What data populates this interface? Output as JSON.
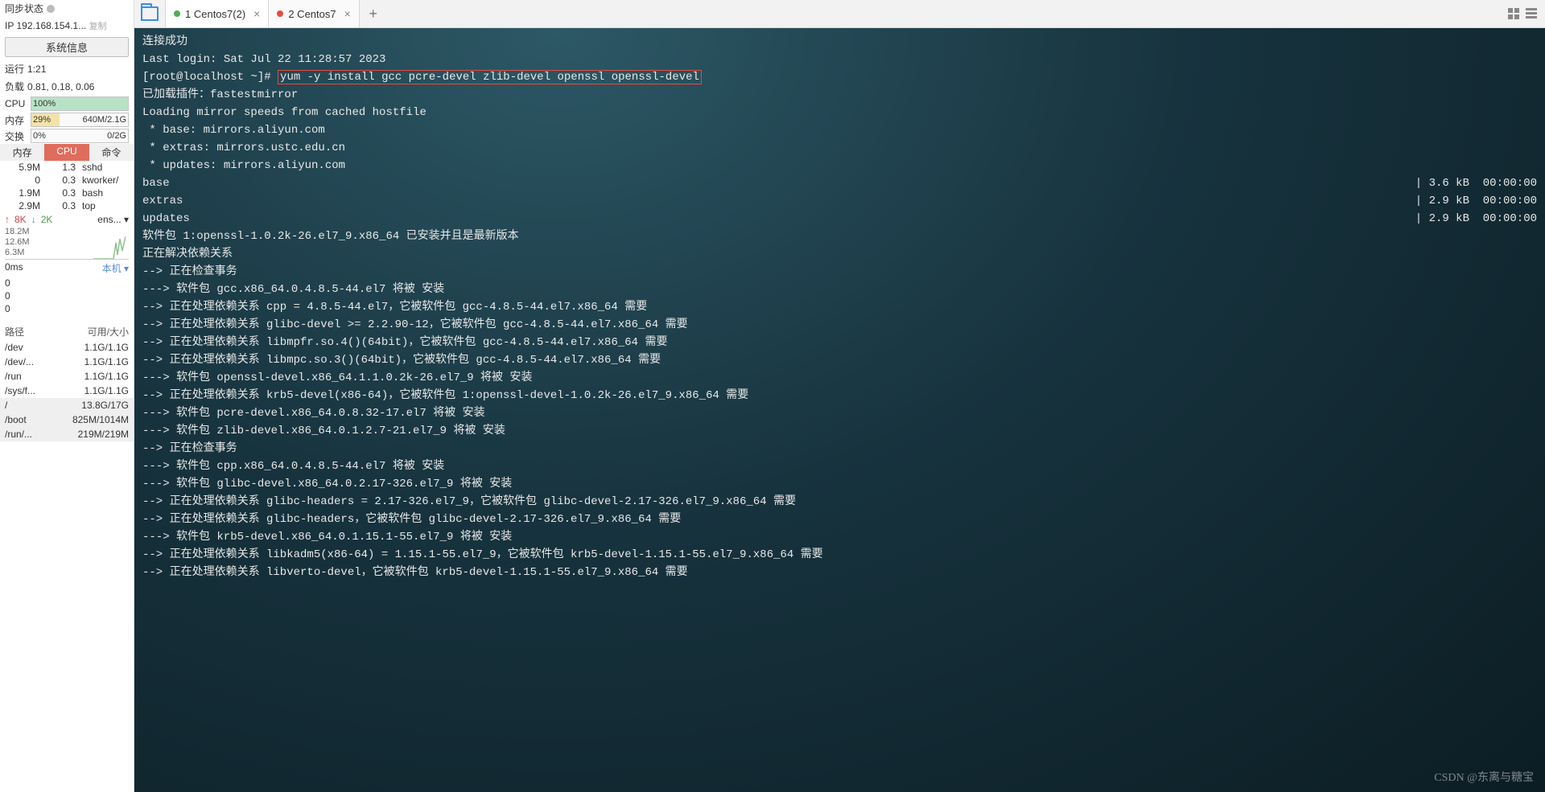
{
  "sidebar": {
    "sync_label": "同步状态",
    "ip_label": "IP",
    "ip_value": "192.168.154.1...",
    "copy_label": "复制",
    "sysinfo_btn": "系统信息",
    "uptime_label": "运行",
    "uptime_value": "1:21",
    "load_label": "负载",
    "load_value": "0.81, 0.18, 0.06",
    "cpu_label": "CPU",
    "cpu_pct": "100%",
    "mem_label": "内存",
    "mem_pct": "29%",
    "mem_text": "640M/2.1G",
    "swap_label": "交换",
    "swap_pct": "0%",
    "swap_text": "0/2G",
    "proc_header": {
      "mem": "内存",
      "cpu": "CPU",
      "cmd": "命令"
    },
    "procs": [
      {
        "mem": "5.9M",
        "cpu": "1.3",
        "cmd": "sshd"
      },
      {
        "mem": "0",
        "cpu": "0.3",
        "cmd": "kworker/"
      },
      {
        "mem": "1.9M",
        "cpu": "0.3",
        "cmd": "bash"
      },
      {
        "mem": "2.9M",
        "cpu": "0.3",
        "cmd": "top"
      }
    ],
    "net": {
      "up": "8K",
      "down": "2K",
      "iface": "ens..."
    },
    "graph_ticks": [
      "18.2M",
      "12.6M",
      "6.3M"
    ],
    "ms_label": "0ms",
    "host_label": "本机",
    "net_zeros": [
      "0",
      "0",
      "0"
    ],
    "disk_header": {
      "path": "路径",
      "size": "可用/大小"
    },
    "disks": [
      {
        "path": "/dev",
        "size": "1.1G/1.1G"
      },
      {
        "path": "/dev/...",
        "size": "1.1G/1.1G"
      },
      {
        "path": "/run",
        "size": "1.1G/1.1G"
      },
      {
        "path": "/sys/f...",
        "size": "1.1G/1.1G"
      },
      {
        "path": "/",
        "size": "13.8G/17G"
      },
      {
        "path": "/boot",
        "size": "825M/1014M"
      },
      {
        "path": "/run/...",
        "size": "219M/219M"
      }
    ]
  },
  "tabs": [
    {
      "dot": "green",
      "label": "1 Centos7(2)",
      "active": true
    },
    {
      "dot": "red",
      "label": "2 Centos7",
      "active": false
    }
  ],
  "terminal": {
    "conn_ok": "连接成功",
    "last_login": "Last login: Sat Jul 22 11:28:57 2023",
    "prompt": "[root@localhost ~]#",
    "cmd": "yum -y install gcc pcre-devel zlib-devel openssl openssl-devel",
    "plugin": "已加载插件：fastestmirror",
    "loading": "Loading mirror speeds from cached hostfile",
    "mirrors": [
      " * base: mirrors.aliyun.com",
      " * extras: mirrors.ustc.edu.cn",
      " * updates: mirrors.aliyun.com"
    ],
    "repos": [
      {
        "name": "base",
        "size": "3.6 kB",
        "time": "00:00:00"
      },
      {
        "name": "extras",
        "size": "2.9 kB",
        "time": "00:00:00"
      },
      {
        "name": "updates",
        "size": "2.9 kB",
        "time": "00:00:00"
      }
    ],
    "body": [
      "软件包 1:openssl-1.0.2k-26.el7_9.x86_64 已安装并且是最新版本",
      "正在解决依赖关系",
      "--> 正在检查事务",
      "---> 软件包 gcc.x86_64.0.4.8.5-44.el7 将被 安装",
      "--> 正在处理依赖关系 cpp = 4.8.5-44.el7，它被软件包 gcc-4.8.5-44.el7.x86_64 需要",
      "--> 正在处理依赖关系 glibc-devel >= 2.2.90-12，它被软件包 gcc-4.8.5-44.el7.x86_64 需要",
      "--> 正在处理依赖关系 libmpfr.so.4()(64bit)，它被软件包 gcc-4.8.5-44.el7.x86_64 需要",
      "--> 正在处理依赖关系 libmpc.so.3()(64bit)，它被软件包 gcc-4.8.5-44.el7.x86_64 需要",
      "---> 软件包 openssl-devel.x86_64.1.1.0.2k-26.el7_9 将被 安装",
      "--> 正在处理依赖关系 krb5-devel(x86-64)，它被软件包 1:openssl-devel-1.0.2k-26.el7_9.x86_64 需要",
      "---> 软件包 pcre-devel.x86_64.0.8.32-17.el7 将被 安装",
      "---> 软件包 zlib-devel.x86_64.0.1.2.7-21.el7_9 将被 安装",
      "--> 正在检查事务",
      "---> 软件包 cpp.x86_64.0.4.8.5-44.el7 将被 安装",
      "---> 软件包 glibc-devel.x86_64.0.2.17-326.el7_9 将被 安装",
      "--> 正在处理依赖关系 glibc-headers = 2.17-326.el7_9，它被软件包 glibc-devel-2.17-326.el7_9.x86_64 需要",
      "--> 正在处理依赖关系 glibc-headers，它被软件包 glibc-devel-2.17-326.el7_9.x86_64 需要",
      "---> 软件包 krb5-devel.x86_64.0.1.15.1-55.el7_9 将被 安装",
      "--> 正在处理依赖关系 libkadm5(x86-64) = 1.15.1-55.el7_9，它被软件包 krb5-devel-1.15.1-55.el7_9.x86_64 需要",
      "--> 正在处理依赖关系 libverto-devel，它被软件包 krb5-devel-1.15.1-55.el7_9.x86_64 需要"
    ]
  },
  "watermark": "CSDN @东离与糖宝"
}
